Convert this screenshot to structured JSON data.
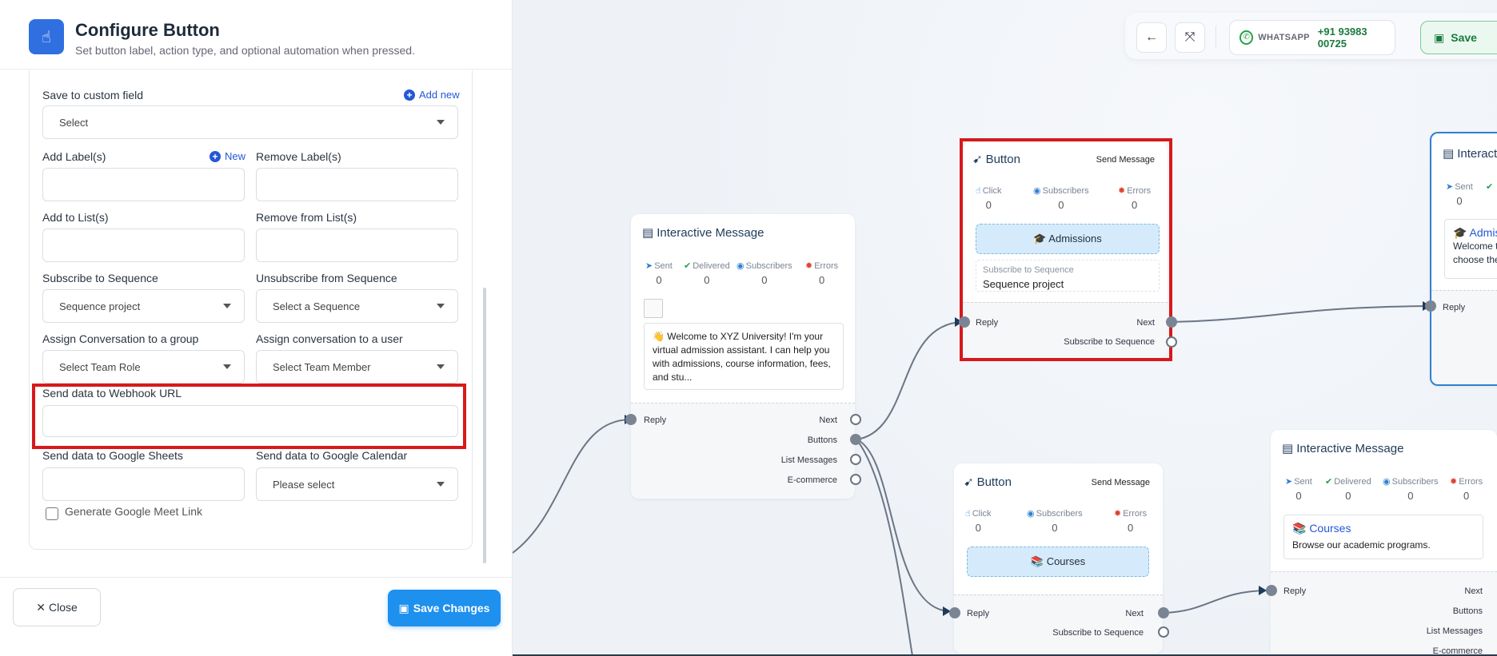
{
  "panel": {
    "title": "Configure Button",
    "subtitle": "Set button label, action type, and optional automation when pressed.",
    "save_custom_field_label": "Save to custom field",
    "add_new_label": "Add new",
    "custom_field_value": "Select",
    "add_labels_label": "Add Label(s)",
    "new_label": "New",
    "remove_labels_label": "Remove Label(s)",
    "add_lists_label": "Add to List(s)",
    "remove_lists_label": "Remove from List(s)",
    "subscribe_seq_label": "Subscribe to Sequence",
    "subscribe_seq_value": "Sequence project",
    "unsubscribe_seq_label": "Unsubscribe from Sequence",
    "unsubscribe_seq_value": "Select a Sequence",
    "assign_group_label": "Assign Conversation to a group",
    "assign_group_value": "Select Team Role",
    "assign_user_label": "Assign conversation to a user",
    "assign_user_value": "Select Team Member",
    "webhook_label": "Send data to Webhook URL",
    "webhook_value": "",
    "sheets_label": "Send data to Google Sheets",
    "calendar_label": "Send data to Google Calendar",
    "calendar_value": "Please select",
    "meet_label": "Generate Google Meet Link",
    "close_label": "Close",
    "save_changes_label": "Save Changes"
  },
  "toolbar": {
    "channel": "WHATSAPP",
    "phone": "+91 93983 00725",
    "save_label": "Save"
  },
  "nodes": {
    "im1": {
      "title": "Interactive Message",
      "stats": [
        {
          "label": "Sent",
          "value": "0"
        },
        {
          "label": "Delivered",
          "value": "0"
        },
        {
          "label": "Subscribers",
          "value": "0"
        },
        {
          "label": "Errors",
          "value": "0"
        }
      ],
      "message": "👋 Welcome to XYZ University! I'm your virtual admission assistant. I can help you with admissions, course information, fees, and stu...",
      "ports": {
        "reply": "Reply",
        "next": "Next",
        "buttons": "Buttons",
        "lists": "List Messages",
        "ecommerce": "E-commerce"
      }
    },
    "btn1": {
      "title": "Button",
      "type": "Send Message",
      "stats": [
        {
          "label": "Click",
          "value": "0"
        },
        {
          "label": "Subscribers",
          "value": "0"
        },
        {
          "label": "Errors",
          "value": "0"
        }
      ],
      "chip": "🎓 Admissions",
      "seq_caption": "Subscribe to Sequence",
      "seq_value": "Sequence project",
      "ports": {
        "reply": "Reply",
        "next": "Next",
        "subscribe": "Subscribe to Sequence"
      }
    },
    "btn2": {
      "title": "Button",
      "type": "Send Message",
      "stats": [
        {
          "label": "Click",
          "value": "0"
        },
        {
          "label": "Subscribers",
          "value": "0"
        },
        {
          "label": "Errors",
          "value": "0"
        }
      ],
      "chip": "📚 Courses",
      "ports": {
        "reply": "Reply",
        "next": "Next",
        "subscribe": "Subscribe to Sequence"
      }
    },
    "im2": {
      "title": "Interactive Message",
      "stats": [
        {
          "label": "Sent",
          "value": "0"
        },
        {
          "label": "Delivered",
          "value": "0"
        },
        {
          "label": "Subscribers",
          "value": "0"
        },
        {
          "label": "Errors",
          "value": "0"
        }
      ],
      "msg_title": "📚 Courses",
      "msg_text": "Browse our academic programs.",
      "ports": {
        "reply": "Reply",
        "next": "Next",
        "buttons": "Buttons",
        "lists": "List Messages",
        "ecommerce": "E-commerce"
      }
    },
    "im3": {
      "title": "Interact",
      "stats": [
        {
          "label": "Sent",
          "value": "0"
        }
      ],
      "msg_title": "🎓 Admis",
      "msg_text_1": "Welcome t",
      "msg_text_2": "choose the",
      "ports": {
        "reply": "Reply"
      }
    }
  }
}
